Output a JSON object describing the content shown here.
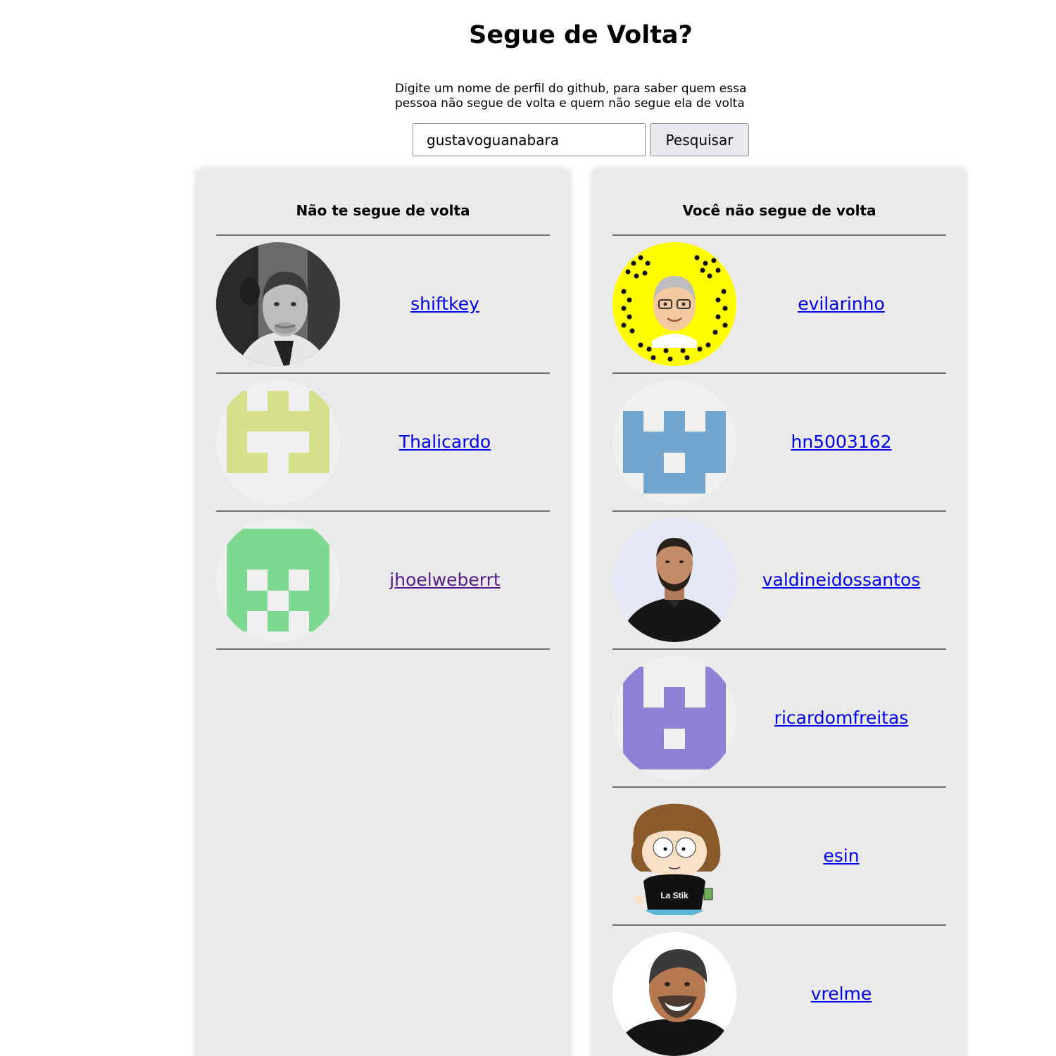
{
  "header": {
    "title": "Segue de Volta?",
    "subtitle": "Digite um nome de perfil do github, para saber quem essa pessoa não segue de volta e quem não segue ela de volta"
  },
  "search": {
    "value": "gustavoguanabara",
    "button_label": "Pesquisar"
  },
  "not_following_back": {
    "title": "Não te segue de volta",
    "users": [
      {
        "login": "shiftkey",
        "avatar": "photo-man-bw"
      },
      {
        "login": "Thalicardo",
        "avatar": "identicon-yellow-green"
      },
      {
        "login": "jhoelweberrt",
        "avatar": "identicon-green",
        "visited": true
      }
    ]
  },
  "you_dont_follow_back": {
    "title": "Você não segue de volta",
    "users": [
      {
        "login": "evilarinho",
        "avatar": "snapcode-bitmoji"
      },
      {
        "login": "hn5003162",
        "avatar": "identicon-blue"
      },
      {
        "login": "valdineidossantos",
        "avatar": "photo-man-beard"
      },
      {
        "login": "ricardomfreitas",
        "avatar": "identicon-purple"
      },
      {
        "login": "esin",
        "avatar": "cartoon-la-stik",
        "avatar_text": "La Stik"
      },
      {
        "login": "vrelme",
        "avatar": "photo-man-smiling"
      }
    ]
  },
  "colors": {
    "panel_background": "#eaeaea",
    "link": "#0000ee",
    "link_visited": "#551a8b",
    "identicon_yellow_green": "#d6e08b",
    "identicon_green": "#7dd990",
    "identicon_blue": "#72a6cf",
    "identicon_purple": "#8f82d6",
    "snapcode_yellow": "#fffc00"
  }
}
